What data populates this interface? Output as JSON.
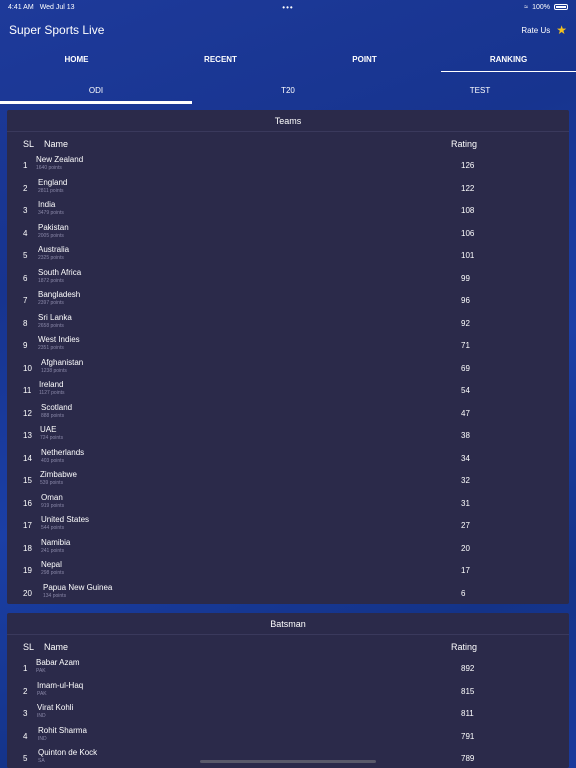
{
  "status": {
    "time": "4:41 AM",
    "date": "Wed Jul 13",
    "dots": "•••",
    "battery": "100%"
  },
  "header": {
    "title": "Super Sports Live",
    "rate_label": "Rate Us"
  },
  "main_tabs": [
    "HOME",
    "RECENT",
    "POINT",
    "RANKING"
  ],
  "sub_tabs": [
    "ODI",
    "T20",
    "TEST"
  ],
  "teams": {
    "title": "Teams",
    "col_sl": "SL",
    "col_name": "Name",
    "col_rating": "Rating",
    "rows": [
      {
        "sl": "1",
        "name": "New Zealand",
        "sub": "1640 points",
        "rating": "126"
      },
      {
        "sl": "2",
        "name": "England",
        "sub": "2811 points",
        "rating": "122"
      },
      {
        "sl": "3",
        "name": "India",
        "sub": "3479 points",
        "rating": "108"
      },
      {
        "sl": "4",
        "name": "Pakistan",
        "sub": "2005 points",
        "rating": "106"
      },
      {
        "sl": "5",
        "name": "Australia",
        "sub": "2325 points",
        "rating": "101"
      },
      {
        "sl": "6",
        "name": "South Africa",
        "sub": "1872 points",
        "rating": "99"
      },
      {
        "sl": "7",
        "name": "Bangladesh",
        "sub": "2397 points",
        "rating": "96"
      },
      {
        "sl": "8",
        "name": "Sri Lanka",
        "sub": "2658 points",
        "rating": "92"
      },
      {
        "sl": "9",
        "name": "West Indies",
        "sub": "2351 points",
        "rating": "71"
      },
      {
        "sl": "10",
        "name": "Afghanistan",
        "sub": "1238 points",
        "rating": "69"
      },
      {
        "sl": "11",
        "name": "Ireland",
        "sub": "1127 points",
        "rating": "54"
      },
      {
        "sl": "12",
        "name": "Scotland",
        "sub": "888 points",
        "rating": "47"
      },
      {
        "sl": "13",
        "name": "UAE",
        "sub": "724 points",
        "rating": "38"
      },
      {
        "sl": "14",
        "name": "Netherlands",
        "sub": "403 points",
        "rating": "34"
      },
      {
        "sl": "15",
        "name": "Zimbabwe",
        "sub": "539 points",
        "rating": "32"
      },
      {
        "sl": "16",
        "name": "Oman",
        "sub": "919 points",
        "rating": "31"
      },
      {
        "sl": "17",
        "name": "United States",
        "sub": "544 points",
        "rating": "27"
      },
      {
        "sl": "18",
        "name": "Namibia",
        "sub": "241 points",
        "rating": "20"
      },
      {
        "sl": "19",
        "name": "Nepal",
        "sub": "298 points",
        "rating": "17"
      },
      {
        "sl": "20",
        "name": "Papua New Guinea",
        "sub": "134 points",
        "rating": "6"
      }
    ]
  },
  "batsman": {
    "title": "Batsman",
    "col_sl": "SL",
    "col_name": "Name",
    "col_rating": "Rating",
    "rows": [
      {
        "sl": "1",
        "name": "Babar Azam",
        "sub": "PAK",
        "rating": "892"
      },
      {
        "sl": "2",
        "name": "Imam-ul-Haq",
        "sub": "PAK",
        "rating": "815"
      },
      {
        "sl": "3",
        "name": "Virat Kohli",
        "sub": "IND",
        "rating": "811"
      },
      {
        "sl": "4",
        "name": "Rohit Sharma",
        "sub": "IND",
        "rating": "791"
      },
      {
        "sl": "5",
        "name": "Quinton de Kock",
        "sub": "SA",
        "rating": "789"
      }
    ]
  },
  "colors": {
    "accent_star": "#f4c21d",
    "panel_bg": "#2b2a4a",
    "muted_text": "#8a88a8"
  }
}
